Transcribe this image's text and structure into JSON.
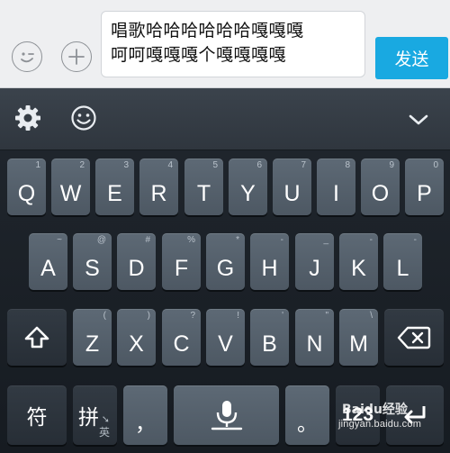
{
  "composer": {
    "message_lines": [
      "唱歌哈哈哈哈哈哈嘎嘎嘎",
      "呵呵嘎嘎嘎个嘎嘎嘎嘎"
    ],
    "send_label": "发送",
    "emoji_icon": "emoji-wink-icon",
    "plus_icon": "plus-icon"
  },
  "toolbar": {
    "settings_icon": "gear-icon",
    "emoji_icon": "smiley-icon",
    "collapse_icon": "chevron-down-icon"
  },
  "keyboard": {
    "row1": [
      {
        "label": "Q",
        "hint": "1"
      },
      {
        "label": "W",
        "hint": "2"
      },
      {
        "label": "E",
        "hint": "3"
      },
      {
        "label": "R",
        "hint": "4"
      },
      {
        "label": "T",
        "hint": "5"
      },
      {
        "label": "Y",
        "hint": "6"
      },
      {
        "label": "U",
        "hint": "7"
      },
      {
        "label": "I",
        "hint": "8"
      },
      {
        "label": "O",
        "hint": "9"
      },
      {
        "label": "P",
        "hint": "0"
      }
    ],
    "row2": [
      {
        "label": "A",
        "hint": "~"
      },
      {
        "label": "S",
        "hint": "@"
      },
      {
        "label": "D",
        "hint": "#"
      },
      {
        "label": "F",
        "hint": "%"
      },
      {
        "label": "G",
        "hint": "*"
      },
      {
        "label": "H",
        "hint": "-"
      },
      {
        "label": "J",
        "hint": "_"
      },
      {
        "label": "K",
        "hint": "-"
      },
      {
        "label": "L",
        "hint": "-"
      }
    ],
    "row3": [
      {
        "label": "Z",
        "hint": "("
      },
      {
        "label": "X",
        "hint": ")"
      },
      {
        "label": "C",
        "hint": "?"
      },
      {
        "label": "V",
        "hint": "!"
      },
      {
        "label": "B",
        "hint": "'"
      },
      {
        "label": "N",
        "hint": "\""
      },
      {
        "label": "M",
        "hint": "\\"
      }
    ],
    "symbol_key": "符",
    "pinyin_key": "拼",
    "pinyin_sub": "英",
    "comma_key": "，",
    "period_key": "。",
    "numbers_key": "123",
    "space_icon": "microphone-icon",
    "shift_icon": "shift-arrow-icon",
    "backspace_icon": "backspace-icon",
    "enter_icon": "enter-icon"
  },
  "watermark": {
    "brand": "Baidu经验",
    "url": "jingyan.baidu.com"
  },
  "colors": {
    "send_button": "#19a9e1",
    "key_face": "#56616c",
    "keyboard_bg": "#1b2128"
  }
}
